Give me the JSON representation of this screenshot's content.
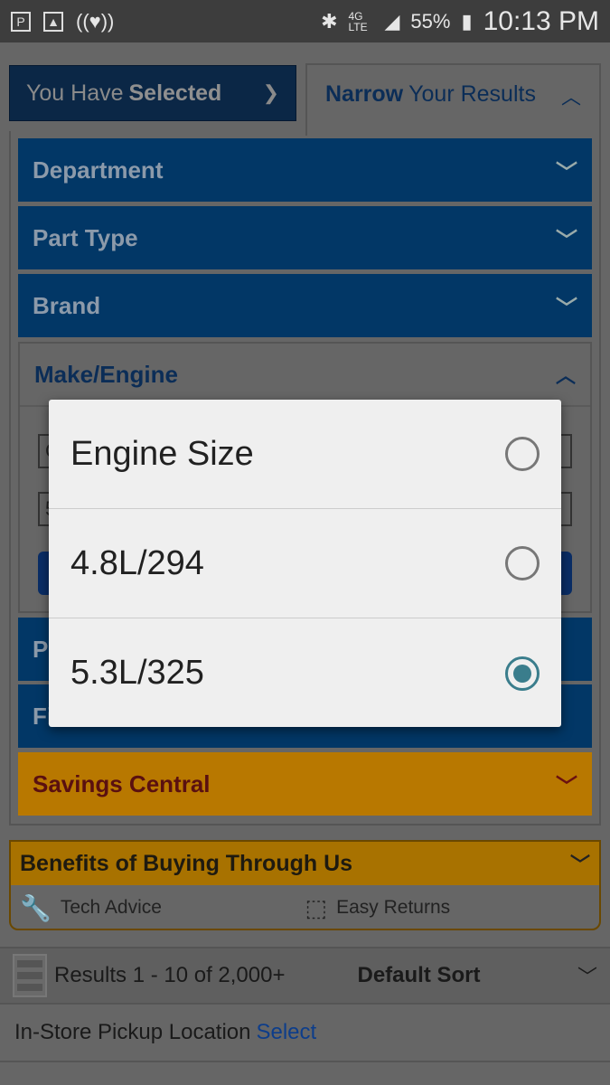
{
  "status_bar": {
    "battery": "55%",
    "time": "10:13 PM",
    "network": "4G LTE",
    "icons": [
      "pandora-icon",
      "gallery-icon",
      "iheartradio-icon",
      "bluetooth-icon",
      "signal-icon",
      "battery-charging-icon"
    ]
  },
  "tabs": {
    "selected_prefix": "You Have",
    "selected_bold": "Selected",
    "narrow_bold": "Narrow",
    "narrow_rest": "Your Results"
  },
  "filters": [
    {
      "label": "Department"
    },
    {
      "label": "Part Type"
    },
    {
      "label": "Brand"
    },
    {
      "label": "Make/Engine",
      "expanded": true,
      "select1_partial": "C",
      "select2_partial": "5"
    },
    {
      "label_partial": "P"
    },
    {
      "label_partial": "Fi"
    },
    {
      "label": "Savings Central"
    }
  ],
  "dialog": {
    "options": [
      {
        "label": "Engine Size",
        "selected": false
      },
      {
        "label": "4.8L/294",
        "selected": false
      },
      {
        "label": "5.3L/325",
        "selected": true
      }
    ],
    "accent": "#3a7d8c"
  },
  "benefits": {
    "title": "Benefits of Buying Through Us",
    "items": [
      "Tech Advice",
      "Easy Returns"
    ]
  },
  "results": {
    "count": "Results 1 - 10 of 2,000+",
    "sort": "Default Sort"
  },
  "pickup": {
    "label": "In-Store Pickup Location",
    "link": "Select"
  }
}
